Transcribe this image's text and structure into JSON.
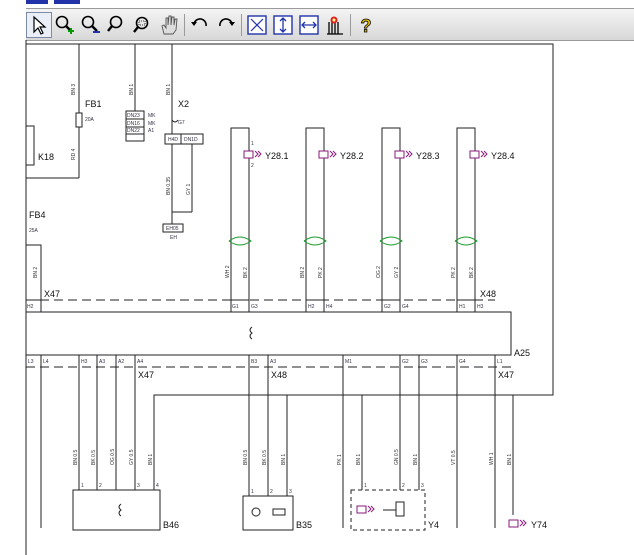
{
  "toolbar": {
    "buttons": [
      {
        "name": "select-arrow-icon"
      },
      {
        "name": "zoom-in-icon"
      },
      {
        "name": "zoom-out-icon"
      },
      {
        "name": "zoom-icon"
      },
      {
        "name": "zoom-window-icon"
      },
      {
        "name": "pan-hand-icon"
      },
      {
        "name": "rotate-back-icon"
      },
      {
        "name": "rotate-forward-icon"
      },
      {
        "name": "fit-window-icon"
      },
      {
        "name": "fit-height-icon"
      },
      {
        "name": "fit-width-icon"
      },
      {
        "name": "component-locate-icon"
      },
      {
        "name": "help-icon"
      }
    ],
    "help_glyph": "?"
  },
  "diagram": {
    "labels": {
      "fb1": "FB1",
      "fb1_rating": "20A",
      "fb4": "FB4",
      "fb4_rating": "25A",
      "k18": "K18",
      "x2": "X2",
      "x2_pin": "G7",
      "x2_ref": "EH",
      "y28_1": "Y28.1",
      "y28_2": "Y28.2",
      "y28_3": "Y28.3",
      "y28_4": "Y28.4",
      "x47_top": "X47",
      "x48_top": "X48",
      "a25": "A25",
      "x47_bot": "X47",
      "x48_bot": "X48",
      "x47_right": "X47",
      "b46": "B46",
      "b35": "B35",
      "y4": "Y4",
      "y74": "Y74"
    },
    "wires_top": [
      "BN 3",
      "BN 1",
      "BN 1",
      "RD 4",
      "BN 0.35",
      "GY 1",
      "BN 2",
      "WH 2",
      "BK 2",
      "BN 2",
      "PK 2",
      "OG 2",
      "GY 2",
      "PK 2",
      "BK 2"
    ],
    "wires_bottom": [
      "BN 0.5",
      "BK 0.5",
      "OG 0.5",
      "GY 0.5",
      "BN 1",
      "BN 0.5",
      "BK 0.5",
      "BN 1",
      "PK 1",
      "BN 1",
      "GN 0.5",
      "BN 1",
      "VT 0.5",
      "WH 1",
      "BN 1"
    ],
    "pins_x47_top": [
      "H2"
    ],
    "pins_x48_top": [
      "G1",
      "G3",
      "H2",
      "H4",
      "G2",
      "G4",
      "H1",
      "H3"
    ],
    "pins_bottom_row": [
      "L3",
      "L4",
      "H3",
      "A3",
      "A2",
      "A4",
      "B3",
      "A3",
      "M1",
      "G2",
      "G3",
      "G4",
      "L1"
    ],
    "x2_block": [
      "DN23",
      "DN16",
      "DN22",
      "MK",
      "MK",
      "A1"
    ],
    "x2_pins": [
      "H4D",
      "DN1D"
    ],
    "eh_label": "EH05",
    "b46_pins": [
      "1",
      "2",
      "3",
      "4"
    ],
    "b35_pins": [
      "1",
      "2",
      "3"
    ],
    "y4_pins": [
      "1",
      "2",
      "3"
    ],
    "y28_pins": [
      "1",
      "2"
    ]
  }
}
